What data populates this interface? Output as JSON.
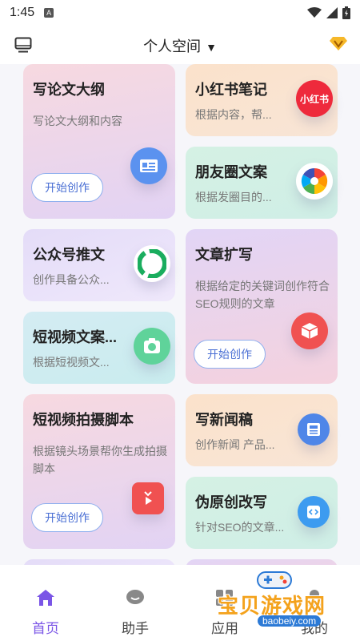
{
  "status": {
    "time": "1:45",
    "notif": "A"
  },
  "header": {
    "title": "个人空间",
    "vip": "V"
  },
  "cards": [
    {
      "title": "写论文大纲",
      "desc": "写论文大纲和内容",
      "button": "开始创作",
      "icon": "document-card-icon"
    },
    {
      "title": "小红书笔记",
      "desc": "根据内容，帮...",
      "icon_text": "小红书",
      "icon": "xiaohongshu-logo-icon"
    },
    {
      "title": "朋友圈文案",
      "desc": "根据发圈目的...",
      "icon": "aperture-icon"
    },
    {
      "title": "公众号推文",
      "desc": "创作具备公众...",
      "icon": "wechat-official-icon"
    },
    {
      "title": "文章扩写",
      "desc": "根据给定的关键词创作符合SEO规则的文章",
      "button": "开始创作",
      "icon": "cube-icon"
    },
    {
      "title": "短视频文案...",
      "desc": "根据短视频文...",
      "icon": "camera-icon"
    },
    {
      "title": "短视频拍摄脚本",
      "desc": "根据镜头场景帮你生成拍摄脚本",
      "button": "开始创作",
      "icon": "tv-play-icon"
    },
    {
      "title": "写新闻稿",
      "desc": "创作新闻 产品...",
      "icon": "news-icon"
    },
    {
      "title": "伪原创改写",
      "desc": "针对SEO的文章...",
      "icon": "code-icon"
    }
  ],
  "tabs": [
    {
      "label": "首页",
      "icon": "home-icon",
      "active": true
    },
    {
      "label": "助手",
      "icon": "chat-icon",
      "active": false
    },
    {
      "label": "应用",
      "icon": "apps-icon",
      "active": false
    },
    {
      "label": "我的",
      "icon": "profile-icon",
      "active": false
    }
  ],
  "watermark": {
    "text": "宝贝游戏网",
    "url": "baobeiy.com"
  }
}
